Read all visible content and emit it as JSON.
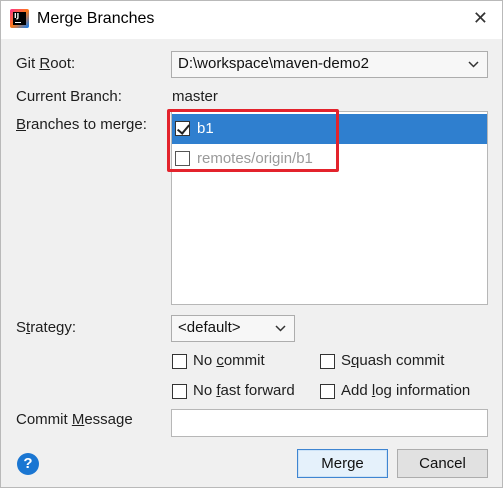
{
  "window": {
    "title": "Merge Branches",
    "app_icon": "intellij-icon",
    "close_label": "✕"
  },
  "git_root": {
    "label_prefix": "Git ",
    "label_key": "R",
    "label_suffix": "oot:",
    "value": "D:\\workspace\\maven-demo2"
  },
  "current_branch": {
    "label": "Current Branch:",
    "value": "master"
  },
  "branches": {
    "label_key": "B",
    "label_rest": "ranches to merge:",
    "items": [
      {
        "label": "b1",
        "checked": true,
        "selected": true
      },
      {
        "label": "remotes/origin/b1",
        "checked": false,
        "selected": false
      }
    ]
  },
  "strategy": {
    "label_prefix": "S",
    "label_key": "t",
    "label_suffix": "rategy:",
    "value": "<default>"
  },
  "options": {
    "no_commit": {
      "prefix": "No ",
      "key": "c",
      "suffix": "ommit",
      "checked": false
    },
    "squash_commit": {
      "prefix": "S",
      "key": "q",
      "suffix": "uash commit",
      "checked": false
    },
    "no_fast_forward": {
      "prefix": "No ",
      "key": "f",
      "suffix": "ast forward",
      "checked": false
    },
    "add_log": {
      "prefix": "Add ",
      "key": "l",
      "suffix": "og information",
      "checked": false
    }
  },
  "commit_message": {
    "label_prefix": "Commit ",
    "label_key": "M",
    "label_suffix": "essage",
    "value": ""
  },
  "buttons": {
    "help": "?",
    "merge": "Merge",
    "cancel": "Cancel"
  },
  "colors": {
    "selection": "#2f7fcf",
    "highlight_box": "#e3232c",
    "help_icon": "#1a76d2"
  }
}
